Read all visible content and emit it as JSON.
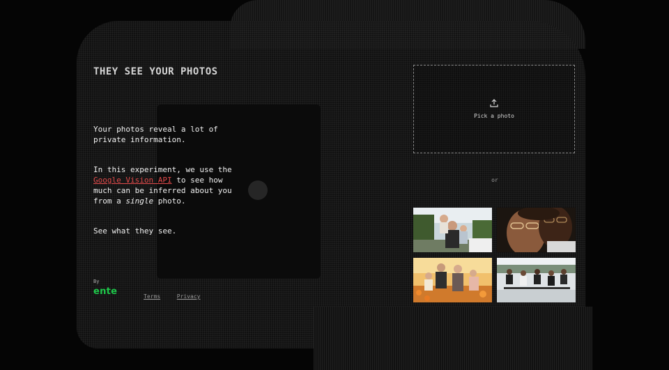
{
  "header": {
    "title": "THEY SEE YOUR PHOTOS"
  },
  "intro": {
    "p1": "Your photos reveal a lot of private information.",
    "p2_before": "In this experiment, we use the",
    "p2_link": "Google Vision API",
    "p2_middle": "to see how much can be inferred about you from a",
    "p2_em": "single",
    "p2_after": "photo.",
    "p3": "See what they see."
  },
  "footer": {
    "by_label": "By",
    "brand": "ente",
    "terms": "Terms",
    "privacy": "Privacy"
  },
  "upload": {
    "label": "Pick a photo",
    "icon": "upload-icon"
  },
  "separator": "or",
  "sample_photos": [
    {
      "name": "family-outdoor-photo"
    },
    {
      "name": "couple-closeup-photo"
    },
    {
      "name": "family-field-photo"
    },
    {
      "name": "group-skateboard-photo"
    }
  ],
  "colors": {
    "background": "#050505",
    "link": "#e24a4a",
    "brand": "#1ec84a",
    "text": "#f0f0f0"
  }
}
